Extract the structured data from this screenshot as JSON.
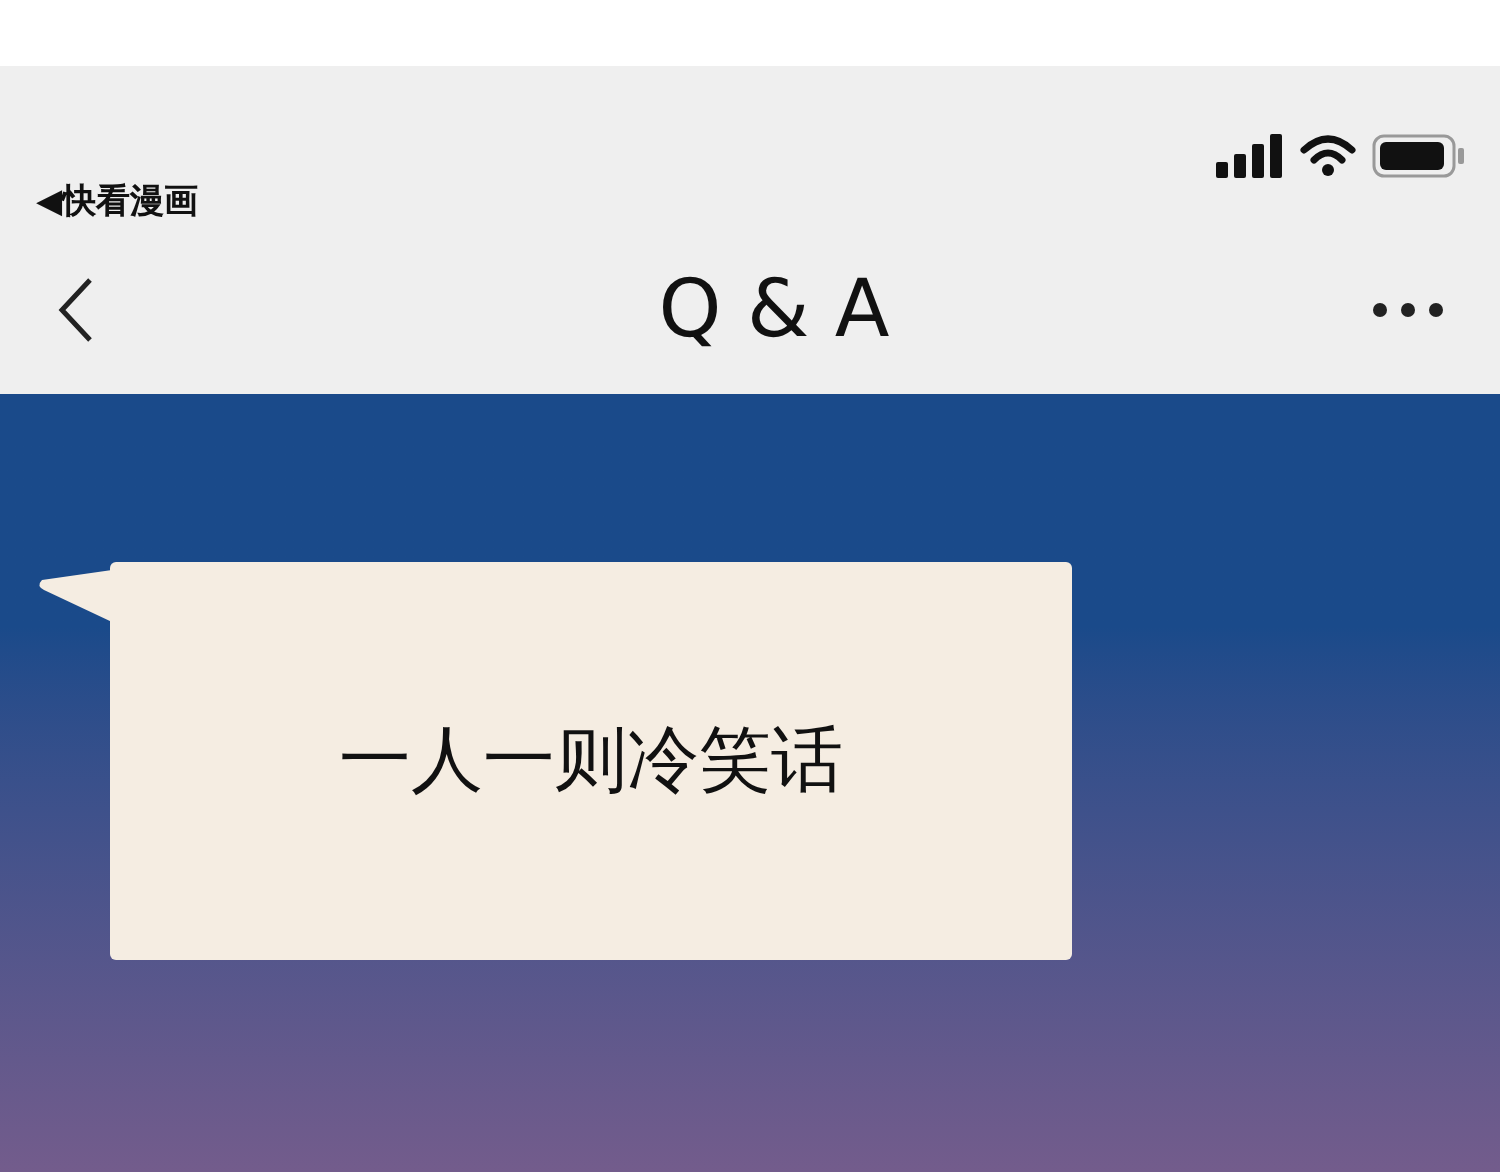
{
  "status_bar": {
    "back_app": "◀快看漫画"
  },
  "nav_bar": {
    "title": "Q & A"
  },
  "speech_bubble": {
    "text": "一人一则冷笑话"
  }
}
